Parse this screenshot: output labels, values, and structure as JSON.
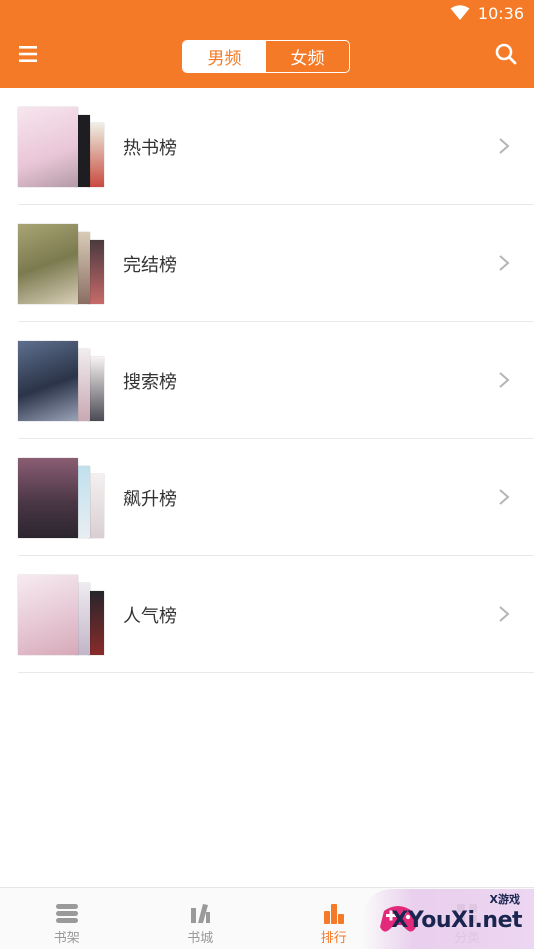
{
  "status_bar": {
    "time": "10:36"
  },
  "toolbar": {
    "tabs": [
      {
        "label": "男频",
        "active": true
      },
      {
        "label": "女频",
        "active": false
      }
    ]
  },
  "rankings": [
    {
      "label": "热书榜",
      "covers": [
        "#f3d9e6",
        "#1e1e22",
        "#e7e9dc"
      ]
    },
    {
      "label": "完结榜",
      "covers": [
        "#8d8a5a",
        "#c9b9a4",
        "#3a2b2f"
      ]
    },
    {
      "label": "搜索榜",
      "covers": [
        "#3b4a63",
        "#ece7ea",
        "#f6f1f0"
      ]
    },
    {
      "label": "飙升榜",
      "covers": [
        "#6f4b5f",
        "#cfe0ea",
        "#f1eeee"
      ]
    },
    {
      "label": "人气榜",
      "covers": [
        "#f1e4ea",
        "#ebe7ee",
        "#1d1d22"
      ]
    }
  ],
  "bottom_nav": [
    {
      "label": "书架",
      "icon": "bookshelf-icon",
      "active": false
    },
    {
      "label": "书城",
      "icon": "bookstore-icon",
      "active": false
    },
    {
      "label": "排行",
      "icon": "ranking-icon",
      "active": true
    },
    {
      "label": "分类",
      "icon": "category-icon",
      "active": false
    }
  ],
  "watermark": {
    "brand": "XYouXi.net",
    "small": "X游戏"
  },
  "colors": {
    "accent": "#f47a27",
    "text": "#333333",
    "muted": "#999999"
  }
}
